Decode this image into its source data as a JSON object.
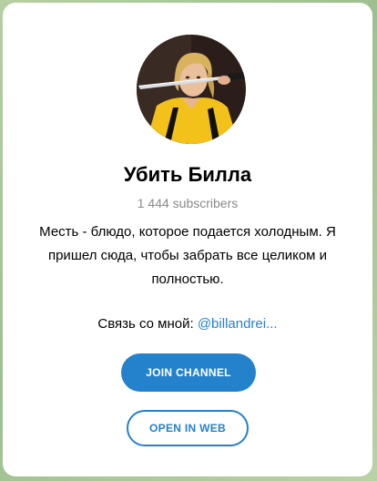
{
  "channel": {
    "name": "Убить Билла",
    "subscribers": "1 444 subscribers",
    "description_line1": "Месть - блюдо, которое подается холодным. Я пришел сюда, чтобы забрать все целиком и полностью.",
    "contact_label": "Связь со мной:",
    "contact_link": "@billandrei...",
    "avatar_icon": "channel-avatar-photo"
  },
  "actions": {
    "join_label": "JOIN CHANNEL",
    "open_web_label": "OPEN IN WEB"
  },
  "colors": {
    "accent": "#2481cc",
    "subtle_text": "#8a8a8a",
    "background": "#a8c79a"
  }
}
